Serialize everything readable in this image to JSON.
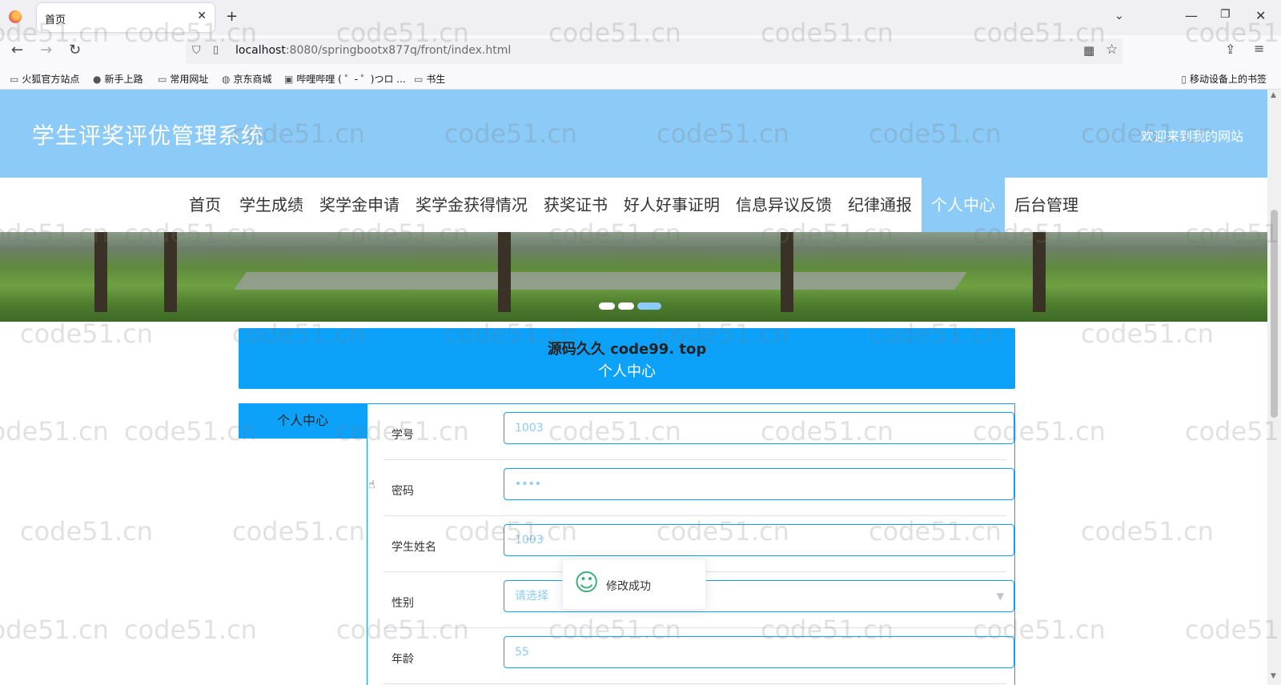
{
  "browser": {
    "tab_title": "首页",
    "url_host": "localhost",
    "url_rest": ":8080/springbootx877q/front/index.html",
    "bookmarks": [
      "火狐官方站点",
      "新手上路",
      "常用网址",
      "京东商城",
      "哔哩哔哩 ( ゜- ゜)つロ ...",
      "书生"
    ],
    "mobile_bookmarks": "移动设备上的书签"
  },
  "site": {
    "title": "学生评奖评优管理系统",
    "welcome": "欢迎来到我的网站"
  },
  "nav": {
    "items": [
      "首页",
      "学生成绩",
      "奖学金申请",
      "奖学金获得情况",
      "获奖证书",
      "好人好事证明",
      "信息异议反馈",
      "纪律通报",
      "个人中心",
      "后台管理"
    ],
    "active": "个人中心"
  },
  "carousel": {
    "slides": 3,
    "active_index": 2
  },
  "section": {
    "overlay_text": "源码久久 code99. top",
    "title": "个人中心"
  },
  "sidebar": {
    "items": [
      "个人中心"
    ]
  },
  "form": {
    "fields": [
      {
        "label": "学号",
        "value": "1003"
      },
      {
        "label": "密码",
        "value": "••••"
      },
      {
        "label": "学生姓名",
        "value": "1003"
      },
      {
        "label": "性别",
        "placeholder": "请选择"
      },
      {
        "label": "年龄",
        "value": "55"
      }
    ]
  },
  "toast": {
    "message": "修改成功"
  },
  "watermark": "code51.cn",
  "colors": {
    "header": "#8ccbf7",
    "accent": "#0da2fa",
    "success": "#3db07a"
  }
}
